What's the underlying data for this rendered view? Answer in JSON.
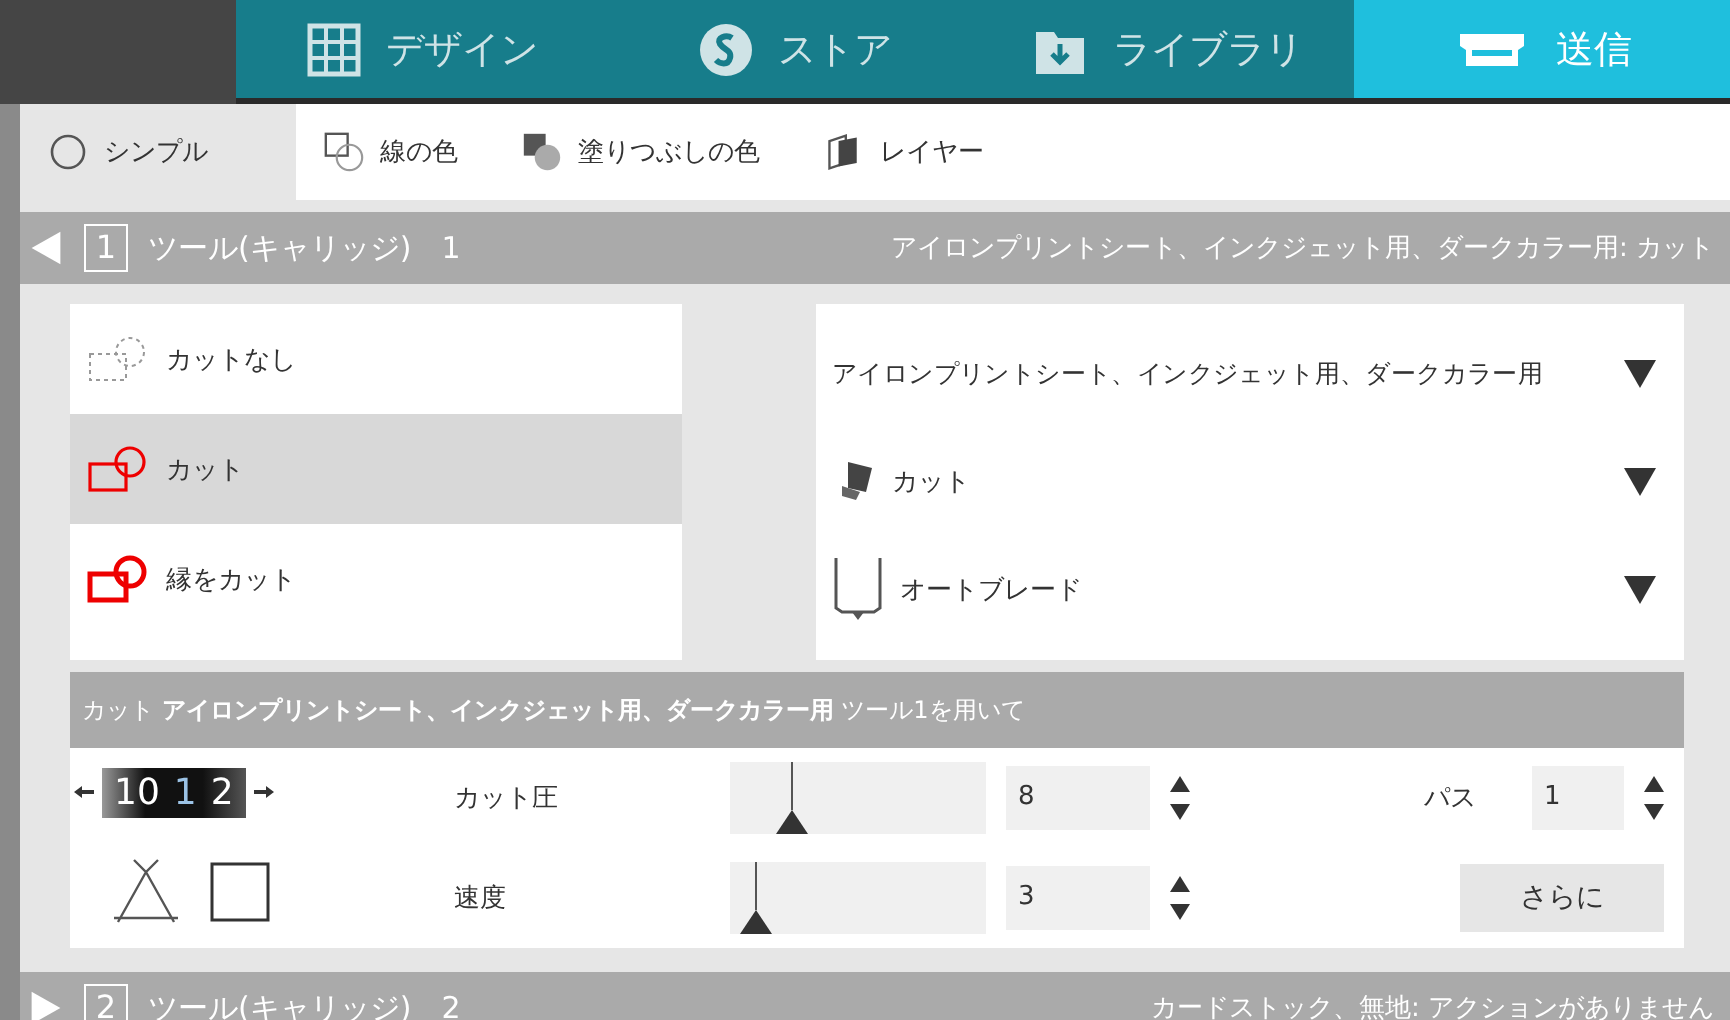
{
  "nav_tabs": [
    {
      "label": "デザイン",
      "kind": "grid",
      "selected": false
    },
    {
      "label": "ストア",
      "kind": "store",
      "selected": false
    },
    {
      "label": "ライブラリ",
      "kind": "library",
      "selected": false
    },
    {
      "label": "送信",
      "kind": "send",
      "selected": true
    }
  ],
  "modes": [
    {
      "label": "シンプル",
      "kind": "radio",
      "selected": true
    },
    {
      "label": "線の色",
      "kind": "line",
      "selected": false
    },
    {
      "label": "塗りつぶしの色",
      "kind": "fill",
      "selected": false
    },
    {
      "label": "レイヤー",
      "kind": "layer",
      "selected": false
    }
  ],
  "tools": [
    {
      "number": "1",
      "title": "ツール(キャリッジ)　1",
      "summary": "アイロンプリントシート、インクジェット用、ダークカラー用: カット",
      "expanded": true
    },
    {
      "number": "2",
      "title": "ツール(キャリッジ)　2",
      "summary": "カードストック、無地: アクションがありません",
      "expanded": false
    }
  ],
  "cut_options": [
    {
      "label": "カットなし",
      "kind": "none",
      "selected": false
    },
    {
      "label": "カット",
      "kind": "cut",
      "selected": true
    },
    {
      "label": "縁をカット",
      "kind": "edge",
      "selected": false
    }
  ],
  "settings": [
    {
      "label": "アイロンプリントシート、インクジェット用、ダークカラー用",
      "kind": "material"
    },
    {
      "label": "カット",
      "kind": "action"
    },
    {
      "label": "オートブレード",
      "kind": "blade"
    }
  ],
  "summary_bar": "カット **アイロンプリントシート、インクジェット用、ダークカラー用** ツール1を用いて",
  "dial": [
    {
      "value": "10",
      "selected": false
    },
    {
      "value": "1",
      "selected": true
    },
    {
      "value": "2",
      "selected": false
    }
  ],
  "sliders": [
    {
      "label": "カット圧",
      "level": 0.24,
      "value": "8"
    },
    {
      "label": "速度",
      "level": 0.1,
      "value": "3"
    }
  ],
  "passes": {
    "label": "パス",
    "value": "1"
  },
  "more_button": "さらに"
}
